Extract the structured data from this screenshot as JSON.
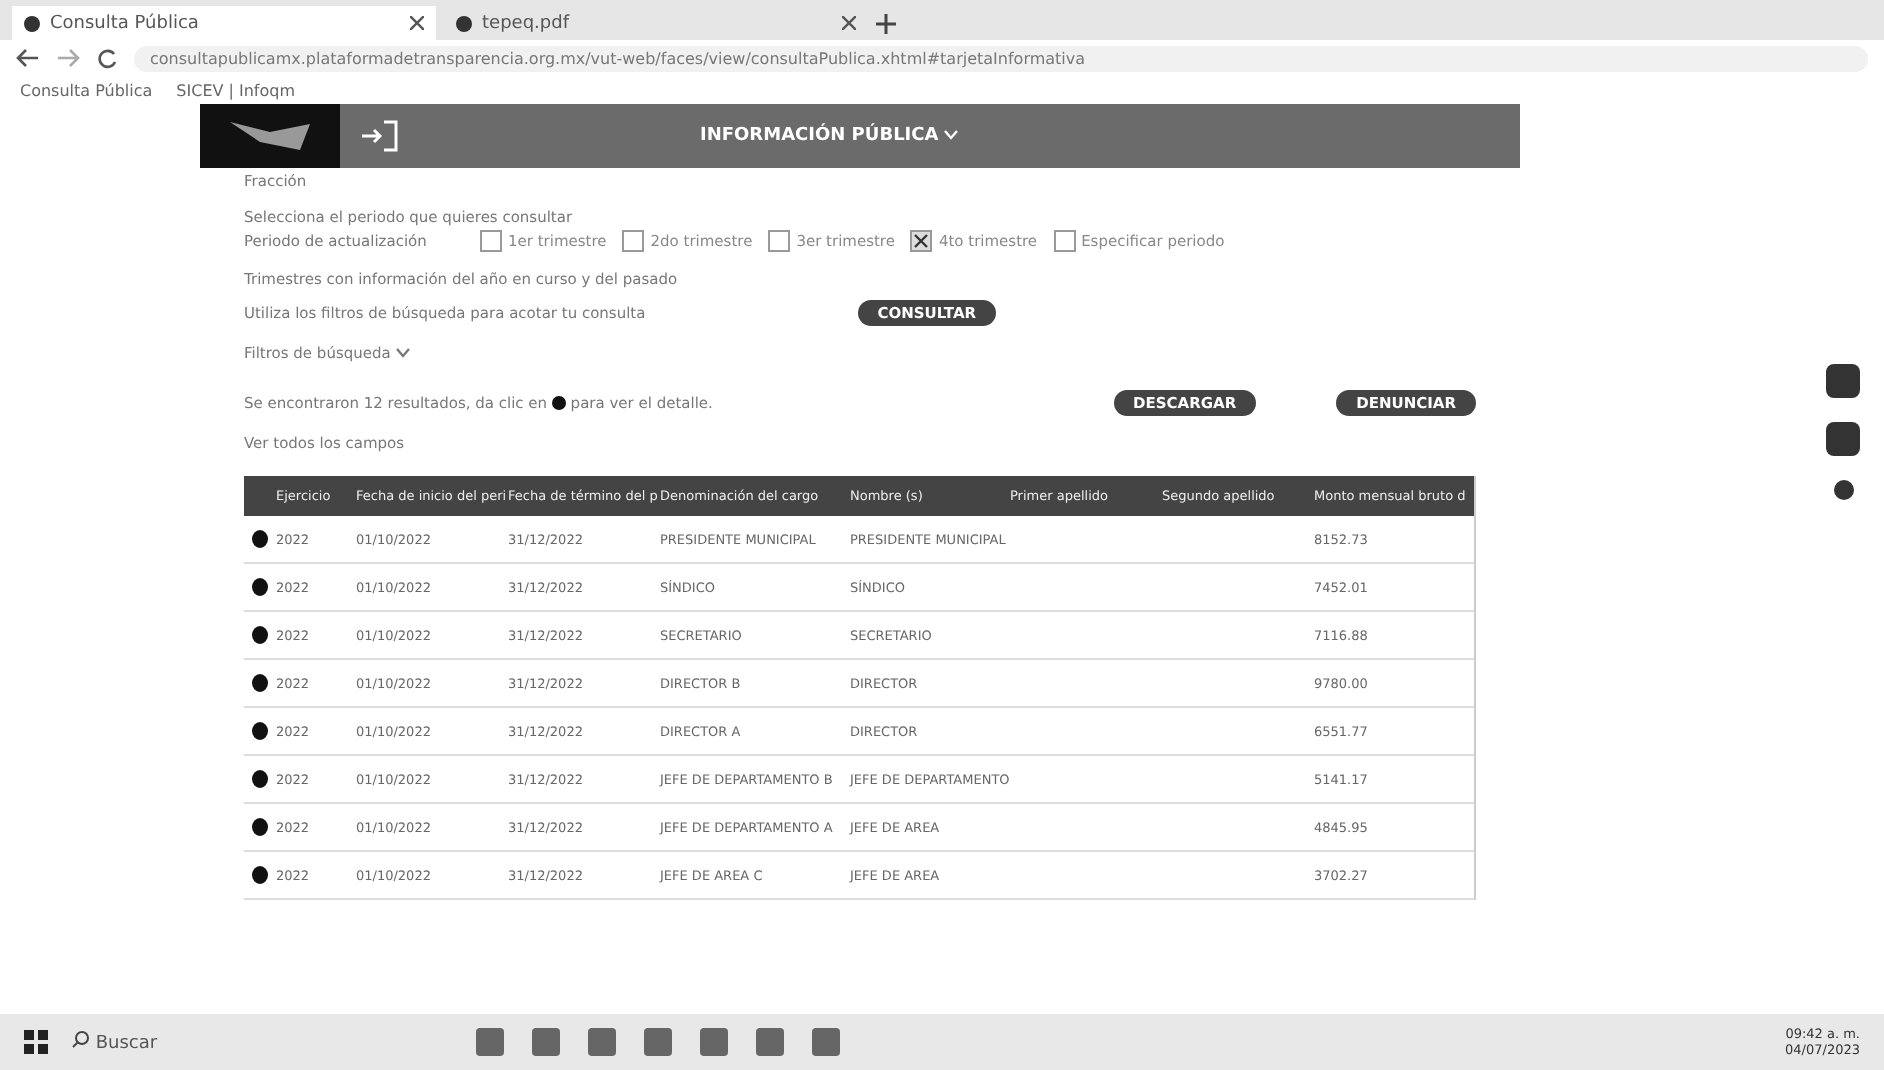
{
  "browser": {
    "tabs": [
      {
        "title": "Consulta Pública",
        "selected": true
      },
      {
        "title": "tepeq.pdf",
        "selected": false
      }
    ],
    "address": "consultapublicamx.plataformadetransparencia.org.mx/vut-web/faces/view/consultaPublica.xhtml#tarjetaInformativa",
    "bookmarks": [
      "Consulta Pública",
      "SICEV | Infoqm"
    ]
  },
  "header": {
    "menu": "INFORMACIÓN PÚBLICA"
  },
  "form": {
    "fraction_label": "Fracción",
    "period_prompt": "Selecciona el periodo que quieres consultar",
    "period_label": "Periodo de actualización",
    "periods": [
      {
        "label": "1er trimestre",
        "checked": false
      },
      {
        "label": "2do trimestre",
        "checked": false
      },
      {
        "label": "3er trimestre",
        "checked": false
      },
      {
        "label": "4to trimestre",
        "checked": true
      },
      {
        "label": "Especificar periodo",
        "checked": false
      }
    ],
    "note": "Trimestres con información del año en curso y del pasado",
    "filter_hint": "Utiliza los filtros de búsqueda para acotar tu consulta",
    "consult_button": "CONSULTAR",
    "filters_toggle": "Filtros de búsqueda"
  },
  "results": {
    "summary_before": "Se encontraron 12 resultados, da clic en",
    "summary_after": "para ver el detalle.",
    "download_button": "DESCARGAR",
    "report_button": "DENUNCIAR",
    "show_all": "Ver todos los campos"
  },
  "table": {
    "columns": [
      "Ejercicio",
      "Fecha de inicio del peri",
      "Fecha de término del p",
      "Denominación del cargo",
      "Nombre (s)",
      "Primer apellido",
      "Segundo apellido",
      "Monto mensual bruto d"
    ],
    "rows": [
      {
        "cells": [
          "2022",
          "01/10/2022",
          "31/12/2022",
          "PRESIDENTE MUNICIPAL",
          "PRESIDENTE MUNICIPAL",
          "",
          "",
          "8152.73"
        ]
      },
      {
        "cells": [
          "2022",
          "01/10/2022",
          "31/12/2022",
          "SÍNDICO",
          "SÍNDICO",
          "",
          "",
          "7452.01"
        ]
      },
      {
        "cells": [
          "2022",
          "01/10/2022",
          "31/12/2022",
          "SECRETARIO",
          "SECRETARIO",
          "",
          "",
          "7116.88"
        ]
      },
      {
        "cells": [
          "2022",
          "01/10/2022",
          "31/12/2022",
          "DIRECTOR B",
          "DIRECTOR",
          "",
          "",
          "9780.00"
        ]
      },
      {
        "cells": [
          "2022",
          "01/10/2022",
          "31/12/2022",
          "DIRECTOR A",
          "DIRECTOR",
          "",
          "",
          "6551.77"
        ]
      },
      {
        "cells": [
          "2022",
          "01/10/2022",
          "31/12/2022",
          "JEFE DE DEPARTAMENTO B",
          "JEFE DE DEPARTAMENTO",
          "",
          "",
          "5141.17"
        ]
      },
      {
        "cells": [
          "2022",
          "01/10/2022",
          "31/12/2022",
          "JEFE DE DEPARTAMENTO A",
          "JEFE DE AREA",
          "",
          "",
          "4845.95"
        ]
      },
      {
        "cells": [
          "2022",
          "01/10/2022",
          "31/12/2022",
          "JEFE DE AREA C",
          "JEFE DE AREA",
          "",
          "",
          "3702.27"
        ]
      }
    ]
  },
  "taskbar": {
    "search_placeholder": "Buscar",
    "time": "09:42 a. m.",
    "date": "04/07/2023"
  }
}
